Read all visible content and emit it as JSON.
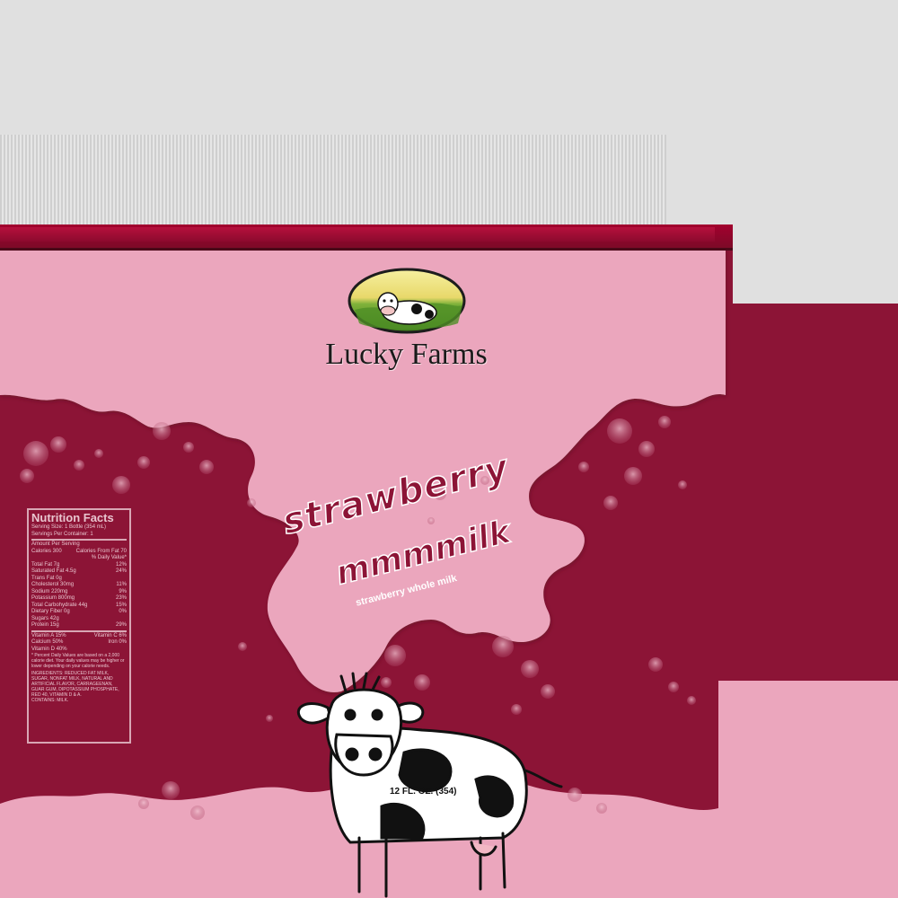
{
  "brand": {
    "name": "Lucky Farms"
  },
  "product": {
    "name_line1": "strawberry",
    "name_line2": "mmmmilk",
    "tagline": "strawberry whole milk",
    "volume": "12 FL. OZ. (354)"
  },
  "nutrition": {
    "title": "Nutrition Facts",
    "serving_size": "Serving Size: 1 Bottle (354 mL)",
    "servings": "Servings Per Container: 1",
    "amount_per": "Amount Per Serving",
    "calories": "Calories   300",
    "calories_fat": "Calories From Fat 70",
    "daily_value": "% Daily Value*",
    "rows": [
      {
        "label": "Total Fat  7g",
        "value": "12%"
      },
      {
        "label": "  Saturated Fat 4.5g",
        "value": "24%"
      },
      {
        "label": "  Trans Fat 0g",
        "value": ""
      },
      {
        "label": "Cholesterol  30mg",
        "value": "11%"
      },
      {
        "label": "Sodium  220mg",
        "value": "9%"
      },
      {
        "label": "Potassium  800mg",
        "value": "23%"
      },
      {
        "label": "Total Carbohydrate  44g",
        "value": "15%"
      },
      {
        "label": "  Dietary Fiber 0g",
        "value": "0%"
      },
      {
        "label": "  Sugars 42g",
        "value": ""
      },
      {
        "label": "Protein  15g",
        "value": "29%"
      }
    ],
    "vitamins": [
      {
        "left": "Vitamin A 15%",
        "right": "Vitamin C 6%"
      },
      {
        "left": "Calcium 50%",
        "right": "Iron 0%"
      },
      {
        "left": "Vitamin D 40%",
        "right": ""
      }
    ],
    "footnote": "* Percent Daily Values are based on a 2,000 calorie diet. Your daily values may be higher or lower depending on your calorie needs.",
    "ingredients": "INGREDIENTS: REDUCED FAT MILK, SUGAR, NONFAT MILK, NATURAL AND ARTIFICIAL FLAVOR, CARRAGEENAN, GUAR GUM, DIPOTASSIUM PHOSPHATE, RED 40, VITAMIN D & A.",
    "contains": "CONTAINS: MILK."
  },
  "colors": {
    "pink": "#eba6bd",
    "maroon": "#8c1436",
    "accent": "#a3002e"
  }
}
